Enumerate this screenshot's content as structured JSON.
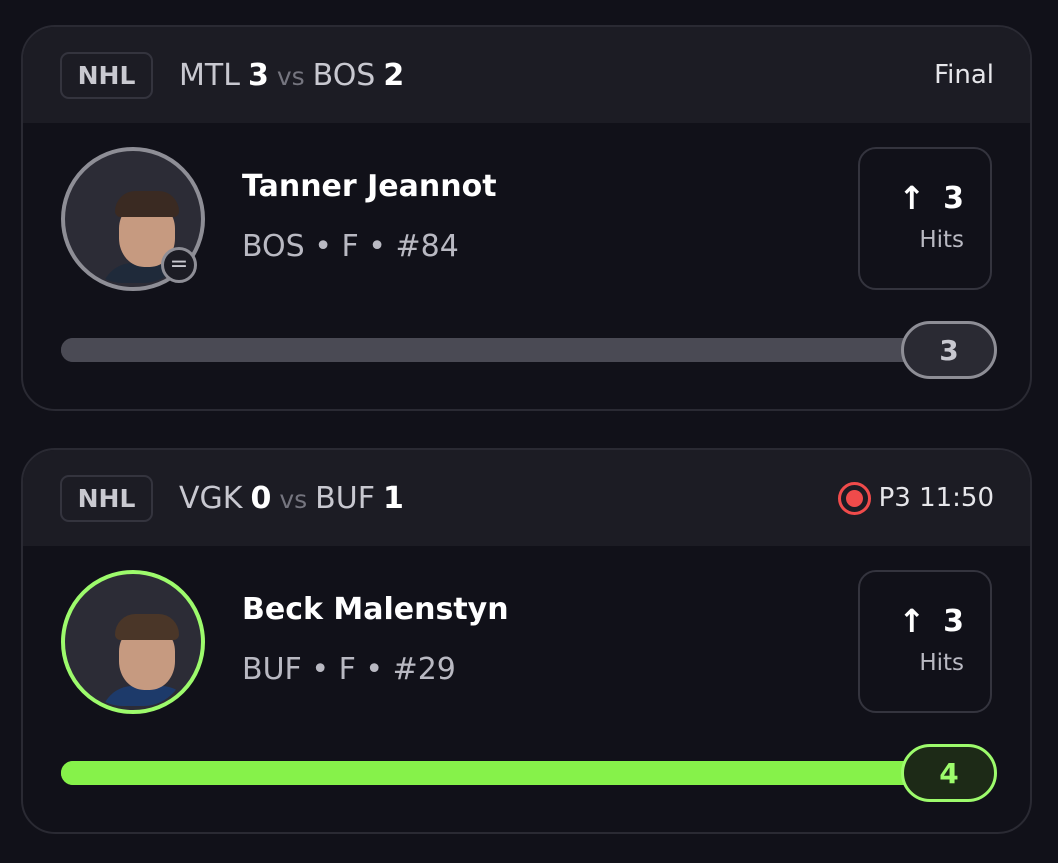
{
  "cards": [
    {
      "league": "NHL",
      "team1": "MTL",
      "score1": "3",
      "vs": "vs",
      "team2": "BOS",
      "score2": "2",
      "status": "Final",
      "player_name": "Tanner Jeannot",
      "player_meta": "BOS • F • #84",
      "stat_value": "3",
      "stat_label": "Hits",
      "progress_value": "3",
      "progress_fraction": 1.0,
      "theme_color": "#8e8e96"
    },
    {
      "league": "NHL",
      "team1": "VGK",
      "score1": "0",
      "vs": "vs",
      "team2": "BUF",
      "score2": "1",
      "status": "P3 11:50",
      "player_name": "Beck Malenstyn",
      "player_meta": "BUF • F • #29",
      "stat_value": "3",
      "stat_label": "Hits",
      "progress_value": "4",
      "progress_fraction": 1.0,
      "theme_color": "#9dfb6c"
    }
  ],
  "icons": {
    "status_badge": "equals-icon",
    "stat_arrow": "arrow-up-icon",
    "live": "live-record-icon"
  },
  "colors": {
    "background": "#111119",
    "live_red": "#f04b4b",
    "green": "#9dfb6c"
  }
}
